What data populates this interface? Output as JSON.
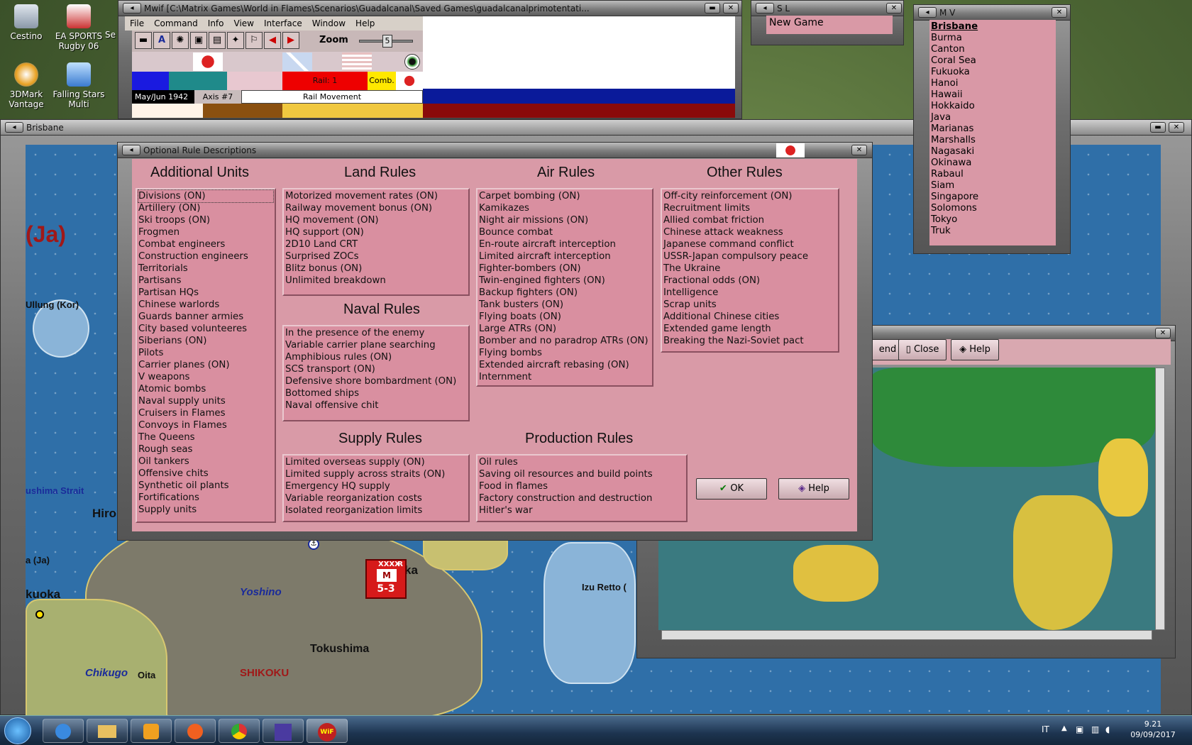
{
  "desktop": {
    "icons": [
      {
        "label": "Cestino"
      },
      {
        "label": "EA SPORTS Rugby 06"
      },
      {
        "label": "3DMark Vantage"
      },
      {
        "label": "Falling Stars Multi"
      }
    ],
    "partial_label": "Se"
  },
  "main_window": {
    "title": "Mwif [C:\\Matrix Games\\World in Flames\\Scenarios\\Guadalcanal\\Saved Games\\guadalcanalprimotentati...",
    "menu": [
      "File",
      "Command",
      "Info",
      "View",
      "Interface",
      "Window",
      "Help"
    ],
    "zoom_label": "Zoom",
    "zoom_value": "5",
    "rail_label": "Rail: 1",
    "comb_label": "Comb.",
    "date": "May/Jun 1942",
    "axis_label": "Axis #7",
    "phase": "Rail Movement"
  },
  "sl_window": {
    "title": "S L",
    "item": "New Game"
  },
  "mv_window": {
    "title": "M V",
    "items": [
      "Brisbane",
      "Burma",
      "Canton",
      "Coral Sea",
      "Fukuoka",
      "Hanoi",
      "Hawaii",
      "Hokkaido",
      "Java",
      "Marianas",
      "Marshalls",
      "Nagasaki",
      "Okinawa",
      "Rabaul",
      "Siam",
      "Singapore",
      "Solomons",
      "Tokyo",
      "Truk"
    ]
  },
  "map_window": {
    "title": "Brisbane"
  },
  "map_labels": {
    "ja": "(Ja)",
    "ullung": "Ullung (Kor)",
    "tsushima": "ushima Strait",
    "hiro": "Hiro",
    "aja": "a (Ja)",
    "fukuoka": "kuoka",
    "yoshino": "Yoshino",
    "chikugo": "Chikugo",
    "oita": "Oita",
    "tokushima": "Tokushima",
    "shikoku": "SHIKOKU",
    "izu": "Izu Retto (",
    "unit_top": "XXXX",
    "unit_r": "R",
    "unit_m": "M",
    "unit_strength": "5-3",
    "ka": "ka"
  },
  "dialog": {
    "title": "Optional Rule Descriptions",
    "additional_units": {
      "title": "Additional Units",
      "items": [
        "Divisions (ON)",
        "Artillery (ON)",
        "Ski troops (ON)",
        "Frogmen",
        "Combat engineers",
        "Construction engineers",
        "Territorials",
        "Partisans",
        "Partisan HQs",
        "Chinese warlords",
        "Guards banner armies",
        "City based volunteeres",
        "Siberians (ON)",
        "Pilots",
        "Carrier planes (ON)",
        "V weapons",
        "Atomic bombs",
        "Naval supply units",
        "Cruisers in Flames",
        "Convoys in Flames",
        "The Queens",
        "Rough seas",
        "Oil tankers",
        "Offensive chits",
        "Synthetic oil plants",
        "Fortifications",
        "Supply units"
      ]
    },
    "land_rules": {
      "title": "Land Rules",
      "items": [
        "Motorized movement rates (ON)",
        "Railway movement bonus (ON)",
        "HQ movement (ON)",
        "HQ support (ON)",
        "2D10 Land CRT",
        "Surprised ZOCs",
        "Blitz bonus (ON)",
        "Unlimited breakdown"
      ]
    },
    "naval_rules": {
      "title": "Naval Rules",
      "items": [
        "In the presence of the enemy",
        "Variable carrier plane searching",
        "Amphibious rules (ON)",
        "SCS transport (ON)",
        "Defensive shore bombardment (ON)",
        "Bottomed ships",
        "Naval offensive chit"
      ]
    },
    "air_rules": {
      "title": "Air Rules",
      "items": [
        "Carpet bombing (ON)",
        "Kamikazes",
        "Night air missions (ON)",
        "Bounce combat",
        "En-route aircraft interception",
        "Limited aircraft interception",
        "Fighter-bombers (ON)",
        "Twin-engined fighters (ON)",
        "Backup fighters (ON)",
        "Tank busters (ON)",
        "Flying boats (ON)",
        "Large ATRs (ON)",
        "Bomber and no paradrop ATRs (ON)",
        "Flying bombs",
        "Extended aircraft rebasing (ON)",
        "Internment"
      ]
    },
    "other_rules": {
      "title": "Other Rules",
      "items": [
        "Off-city reinforcement (ON)",
        "Recruitment limits",
        "Allied combat friction",
        "Chinese attack weakness",
        "Japanese command conflict",
        "USSR-Japan compulsory peace",
        "The Ukraine",
        "Fractional odds (ON)",
        "Intelligence",
        "Scrap units",
        "Additional Chinese cities",
        "Extended game length",
        "Breaking the Nazi-Soviet pact"
      ]
    },
    "supply_rules": {
      "title": "Supply Rules",
      "items": [
        "Limited overseas supply (ON)",
        "Limited supply across straits (ON)",
        "Emergency HQ supply",
        "Variable reorganization costs",
        "Isolated reorganization limits"
      ]
    },
    "production_rules": {
      "title": "Production Rules",
      "items": [
        "Oil rules",
        "Saving oil resources and build points",
        "Food in flames",
        "Factory construction and destruction",
        "Hitler's war"
      ]
    },
    "ok_label": "OK",
    "help_label": "Help"
  },
  "world_window": {
    "end_label": "end",
    "close_label": "Close",
    "help_label": "Help"
  },
  "taskbar": {
    "lang": "IT",
    "time": "9.21",
    "date": "09/09/2017"
  },
  "colors": {
    "pink": "#d99aa7",
    "list_pink": "#d98fa0",
    "sea": "#2f6fa8",
    "unit_red": "#d61a1a"
  }
}
